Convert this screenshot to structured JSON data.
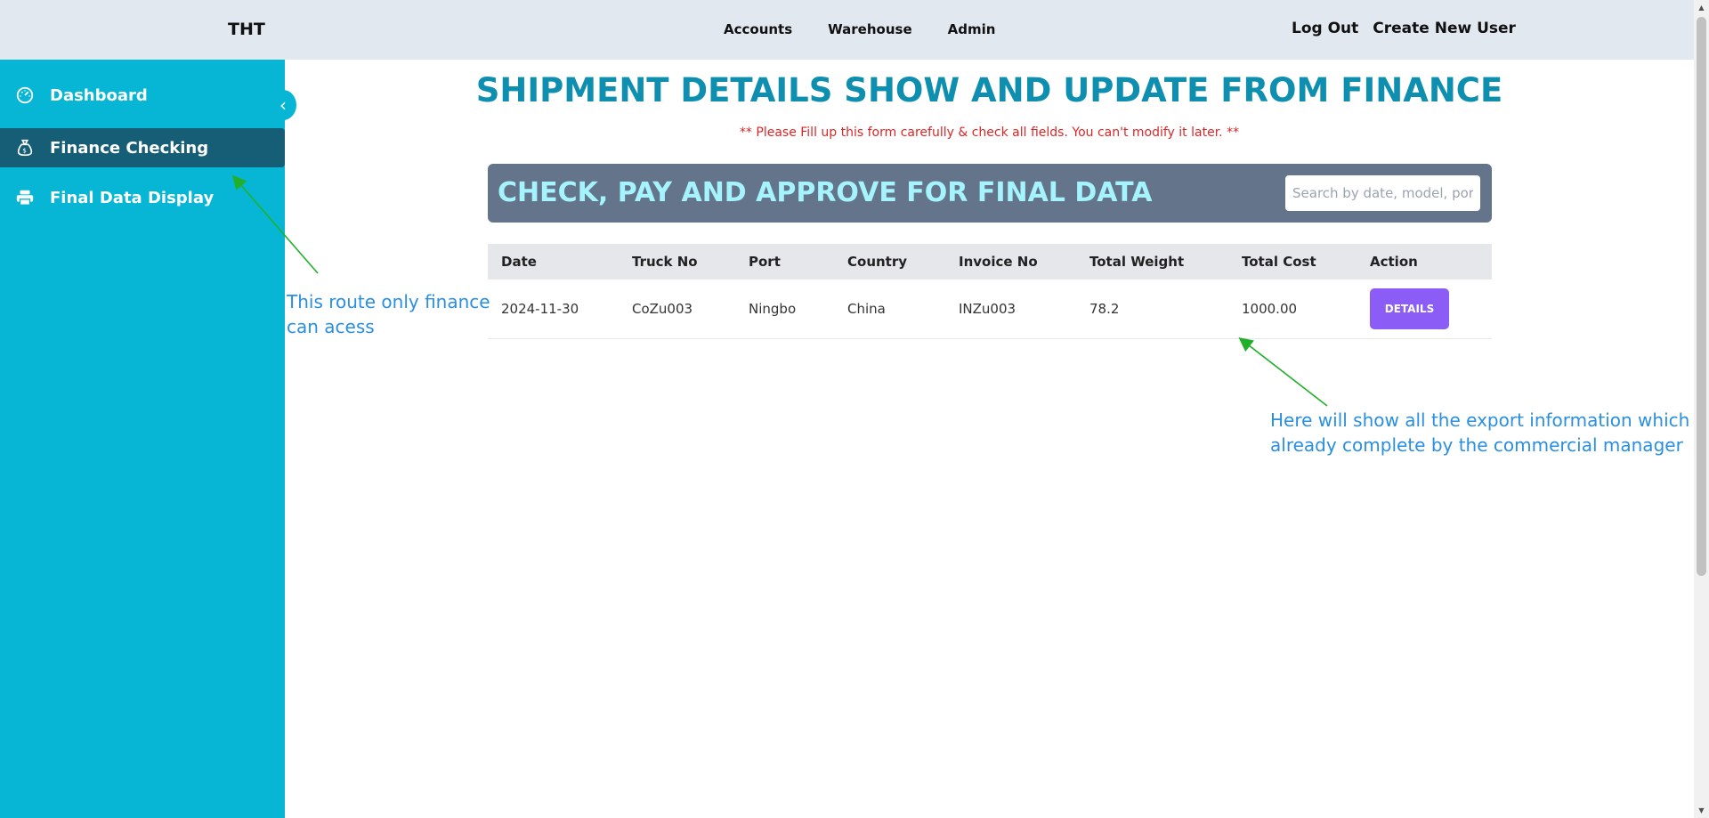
{
  "header": {
    "brand": "THT",
    "nav": [
      "Accounts",
      "Warehouse",
      "Admin"
    ],
    "right_links": [
      "Log Out",
      "Create New User"
    ]
  },
  "sidebar": {
    "items": [
      {
        "label": "Dashboard",
        "icon": "gauge-icon",
        "active": false
      },
      {
        "label": "Finance Checking",
        "icon": "money-bag-icon",
        "active": true
      },
      {
        "label": "Final Data Display",
        "icon": "printer-icon",
        "active": false
      }
    ],
    "collapse_icon": "chevron-left-icon"
  },
  "main": {
    "title": "SHIPMENT DETAILS SHOW AND UPDATE FROM FINANCE",
    "warning": "** Please Fill up this form carefully & check all fields. You can't modify it later. **",
    "panel_title": "CHECK, PAY AND APPROVE FOR FINAL DATA",
    "search": {
      "placeholder": "Search by date, model, port...",
      "value": ""
    },
    "table": {
      "headers": [
        "Date",
        "Truck No",
        "Port",
        "Country",
        "Invoice No",
        "Total Weight",
        "Total Cost",
        "Action"
      ],
      "rows": [
        {
          "date": "2024-11-30",
          "truck_no": "CoZu003",
          "port": "Ningbo",
          "country": "China",
          "invoice_no": "INZu003",
          "total_weight": "78.2",
          "total_cost": "1000.00",
          "action": "DETAILS"
        }
      ]
    }
  },
  "annotations": {
    "left": "This route only finance can acess",
    "right": "Here will show all the export information which already complete by the commercial manager"
  },
  "colors": {
    "sidebar": "#06b6d4",
    "sidebar_active": "#155e75",
    "title": "#0e8fb0",
    "warning": "#dc2626",
    "panel": "#64748b",
    "panel_title": "#a5f3fc",
    "button": "#8b5cf6",
    "annotation": "#2a8fe0",
    "arrow": "#22b02a"
  }
}
